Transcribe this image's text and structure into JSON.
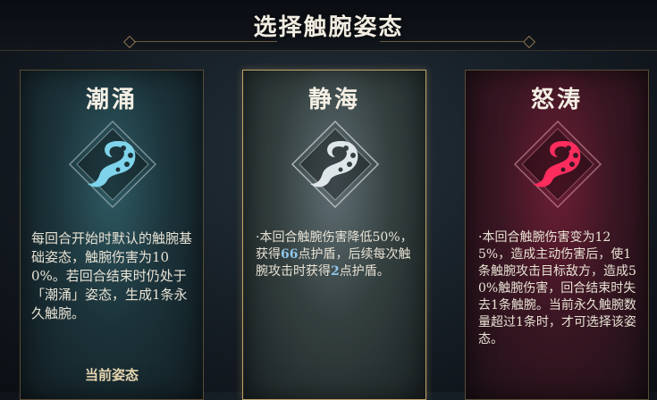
{
  "header": {
    "title": "选择触腕姿态"
  },
  "cards": [
    {
      "name": "潮涌",
      "icon": "tentacle-icon",
      "accent": "#7fd3ea",
      "description": "每回合开始时默认的触腕基础姿态，触腕伤害为100%。若回合结束时仍处于「潮涌」姿态，生成1条永久触腕。",
      "status": "当前姿态"
    },
    {
      "name": "静海",
      "icon": "tentacle-icon",
      "accent": "#dfe6ea",
      "desc_parts": {
        "p1": "·本回合触腕伤害降低50%，获得",
        "v1": "66",
        "p2": "点护盾，后续每次触腕攻击时获得",
        "v2": "2",
        "p3": "点护盾。"
      }
    },
    {
      "name": "怒涛",
      "icon": "tentacle-icon",
      "accent": "#ff2d5e",
      "description": "·本回合触腕伤害变为125%，造成主动伤害后，使1条触腕攻击目标敌方，造成50%触腕伤害，回合结束时失去1条触腕。当前永久触腕数量超过1条时，才可选择该姿态。"
    }
  ]
}
